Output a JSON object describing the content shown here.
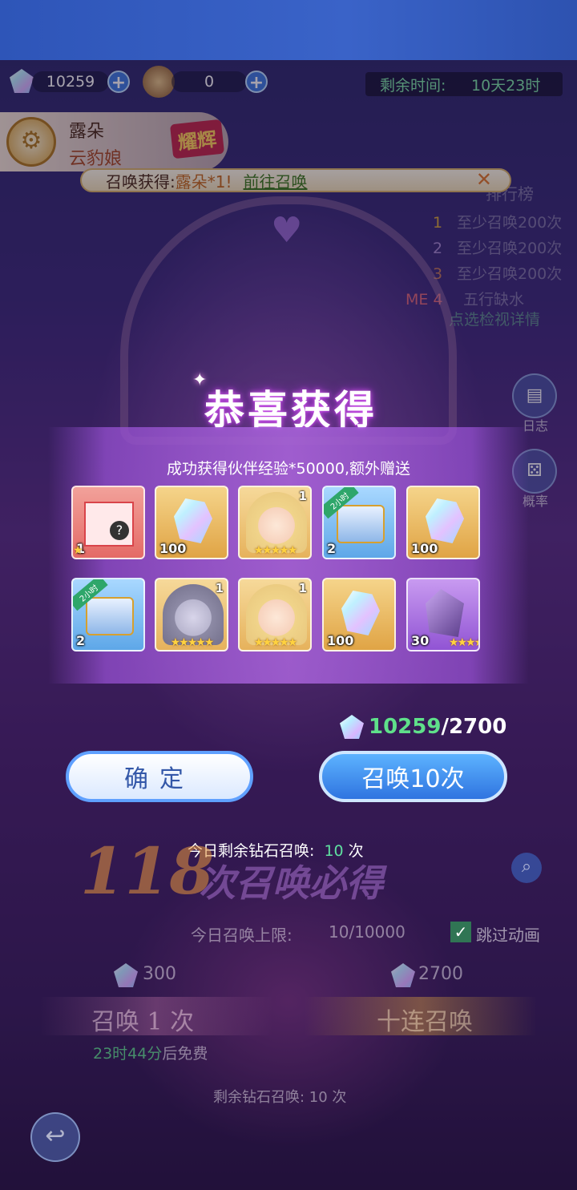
{
  "currency": {
    "gems": "10259",
    "tickets": "0"
  },
  "timer": {
    "label": "剩余时间:",
    "value": "10天23时"
  },
  "banner": {
    "name": "露朵",
    "subtitle": "云豹娘",
    "tag": "耀辉"
  },
  "notice": {
    "text": "召唤获得:",
    "name": "露朵*1!",
    "link": "前往召唤"
  },
  "ranking": {
    "title": "排行榜",
    "rows": [
      {
        "rank": "1",
        "text": "至少召唤200次"
      },
      {
        "rank": "2",
        "text": "至少召唤200次"
      },
      {
        "rank": "3",
        "text": "至少召唤200次"
      },
      {
        "rank": "ME 4",
        "text": "五行缺水"
      }
    ],
    "link": "点选检视详情"
  },
  "side": {
    "log": "日志",
    "rate": "概率"
  },
  "reward": {
    "title": "恭喜获得",
    "subtitle": "成功获得伙伴经验*50000,额外赠送",
    "items": [
      {
        "kind": "gift-box-icon",
        "count": "1",
        "tr": "",
        "frame": "red",
        "stars": "★",
        "ribbon": ""
      },
      {
        "kind": "crystal-icon",
        "count": "100",
        "tr": "",
        "frame": "gold",
        "stars": "",
        "ribbon": ""
      },
      {
        "kind": "character-portrait-icon",
        "count": "",
        "tr": "1",
        "frame": "char",
        "stars": "★★★★★",
        "ribbon": ""
      },
      {
        "kind": "treasure-chest-icon",
        "count": "2",
        "tr": "",
        "frame": "blue",
        "stars": "",
        "ribbon": "2小时"
      },
      {
        "kind": "crystal-icon",
        "count": "100",
        "tr": "",
        "frame": "gold",
        "stars": "",
        "ribbon": ""
      },
      {
        "kind": "treasure-chest-icon",
        "count": "2",
        "tr": "",
        "frame": "blue",
        "stars": "",
        "ribbon": "2小时"
      },
      {
        "kind": "character-portrait-grey-icon",
        "count": "",
        "tr": "1",
        "frame": "char",
        "stars": "★★★★★",
        "ribbon": ""
      },
      {
        "kind": "character-portrait-icon",
        "count": "",
        "tr": "1",
        "frame": "char",
        "stars": "★★★★★",
        "ribbon": ""
      },
      {
        "kind": "crystal-icon",
        "count": "100",
        "tr": "",
        "frame": "gold",
        "stars": "",
        "ribbon": ""
      },
      {
        "kind": "shard-icon",
        "count": "30",
        "tr": "",
        "frame": "purple",
        "stars": "★★★★",
        "ribbon": ""
      }
    ],
    "cost_have": "10259",
    "cost_need": "/2700",
    "confirm": "确定",
    "summon10": "召唤10次",
    "today_label": "今日剩余钻石召唤:",
    "today_count": "10",
    "today_unit": "次"
  },
  "background": {
    "big_number": "118",
    "big_text": "次召唤必得",
    "limit_label": "今日召唤上限:",
    "limit_value": "10/10000",
    "skip": "跳过动画",
    "cost1": "300",
    "cost10": "2700",
    "summon1": "召唤 1 次",
    "summon_ten": "十连召唤",
    "free_time": "23时44分",
    "free_suffix": "后免费",
    "remain": "剩余钻石召唤: 10 次"
  },
  "colors": {
    "accent": "#3e7be0",
    "gold": "#ffd23f",
    "green": "#4fe08a"
  }
}
